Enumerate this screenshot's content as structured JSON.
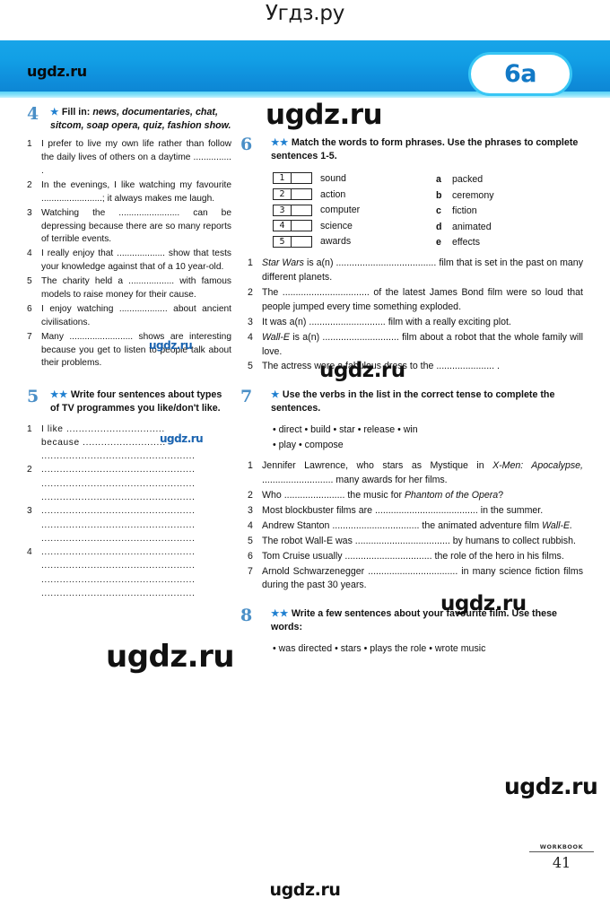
{
  "watermarks": {
    "top": "Угдз.ру",
    "bottom": "ugdz.ru",
    "brand": "ugdz.ru",
    "site": "ugdz.ru"
  },
  "header": {
    "unit_badge": "6a",
    "accent_blue": "#12a0e6",
    "badge_border": "#38c6f4",
    "badge_text_color": "#1279c6"
  },
  "exercises": [
    {
      "number": "4",
      "stars": "★",
      "instruction_plain": "Fill in: ",
      "instruction_italic": "news, documentaries, chat, sitcom, soap opera, quiz, fashion show.",
      "items": [
        {
          "n": "1",
          "text": "I prefer to live my own life rather than follow the daily lives of others on a daytime ............... ."
        },
        {
          "n": "2",
          "text": "In the evenings, I like watching my favourite ........................; it always makes me laugh."
        },
        {
          "n": "3",
          "text": "Watching the ........................ can be depressing because there are so many reports of terrible events."
        },
        {
          "n": "4",
          "text": "I really enjoy that ................... show that tests your knowledge against that of a 10 year-old."
        },
        {
          "n": "5",
          "text": "The charity held a .................. with famous models to raise money for their cause."
        },
        {
          "n": "6",
          "text": "I enjoy watching ................... about ancient civilisations."
        },
        {
          "n": "7",
          "text": "Many ......................... shows are interesting because you get to listen to people talk about their problems."
        }
      ]
    },
    {
      "number": "5",
      "stars": "★★",
      "instruction": "Write four sentences about types of TV programmes you like/don't like.",
      "items": [
        {
          "n": "1",
          "lines": [
            "I like ................................",
            "because ...........................",
            ".................................................."
          ]
        },
        {
          "n": "2",
          "lines": [
            "..................................................",
            "..................................................",
            ".................................................."
          ]
        },
        {
          "n": "3",
          "lines": [
            "..................................................",
            "..................................................",
            ".................................................."
          ]
        },
        {
          "n": "4",
          "lines": [
            "..................................................",
            "..................................................",
            "..................................................",
            ".................................................."
          ]
        }
      ]
    },
    {
      "number": "6",
      "stars": "★★",
      "instruction": "Match the words to form phrases. Use the phrases to complete sentences 1-5.",
      "match_left": [
        {
          "num": "1",
          "word": "sound"
        },
        {
          "num": "2",
          "word": "action"
        },
        {
          "num": "3",
          "word": "computer"
        },
        {
          "num": "4",
          "word": "science"
        },
        {
          "num": "5",
          "word": "awards"
        }
      ],
      "match_right": [
        {
          "letter": "a",
          "word": "packed"
        },
        {
          "letter": "b",
          "word": "ceremony"
        },
        {
          "letter": "c",
          "word": "fiction"
        },
        {
          "letter": "d",
          "word": "animated"
        },
        {
          "letter": "e",
          "word": "effects"
        }
      ],
      "items": [
        {
          "n": "1",
          "pre_italic": "Star Wars",
          "text": " is a(n) ...................................... film that is set in the past on many different planets."
        },
        {
          "n": "2",
          "text": "The ................................. of the latest James Bond film were so loud that people jumped every time something exploded."
        },
        {
          "n": "3",
          "text": "It was a(n) ............................. film with a really exciting plot."
        },
        {
          "n": "4",
          "pre_italic": "Wall-E",
          "text": " is a(n) ............................. film about a robot that the whole family will love."
        },
        {
          "n": "5",
          "text": "The actress wore a fabulous dress to the ...................... ."
        }
      ]
    },
    {
      "number": "7",
      "stars": "★",
      "instruction": "Use the verbs in the list in the correct tense to complete the sentences.",
      "wordbank_line1": "• direct  • build  • star  • release  • win",
      "wordbank_line2": "• play  • compose",
      "items": [
        {
          "n": "1",
          "text": "Jennifer Lawrence, who stars as Mystique in ",
          "italic1": "X-Men: Apocalypse,",
          "text2": " ........................... many awards for her films."
        },
        {
          "n": "2",
          "text": "Who ....................... the music for ",
          "italic1": "Phantom of the Opera",
          "text2": "?"
        },
        {
          "n": "3",
          "text": "Most blockbuster films are ....................................... in the summer."
        },
        {
          "n": "4",
          "text": "Andrew Stanton ................................. the animated adventure film ",
          "italic1": "Wall-E.",
          "text2": ""
        },
        {
          "n": "5",
          "text": "The robot Wall-E was .................................... by humans to collect rubbish."
        },
        {
          "n": "6",
          "text": "Tom Cruise usually ................................. the role of the hero in his films."
        },
        {
          "n": "7",
          "text": "Arnold Schwarzenegger .................................. in many science fiction films during the past 30 years."
        }
      ]
    },
    {
      "number": "8",
      "stars": "★★",
      "instruction": "Write a few sentences about your favourite film. Use these words:",
      "wordbank_line1": "• was directed  • stars  • plays the role  • wrote music"
    }
  ],
  "footer": {
    "label": "WORKBOOK",
    "page": "41"
  }
}
